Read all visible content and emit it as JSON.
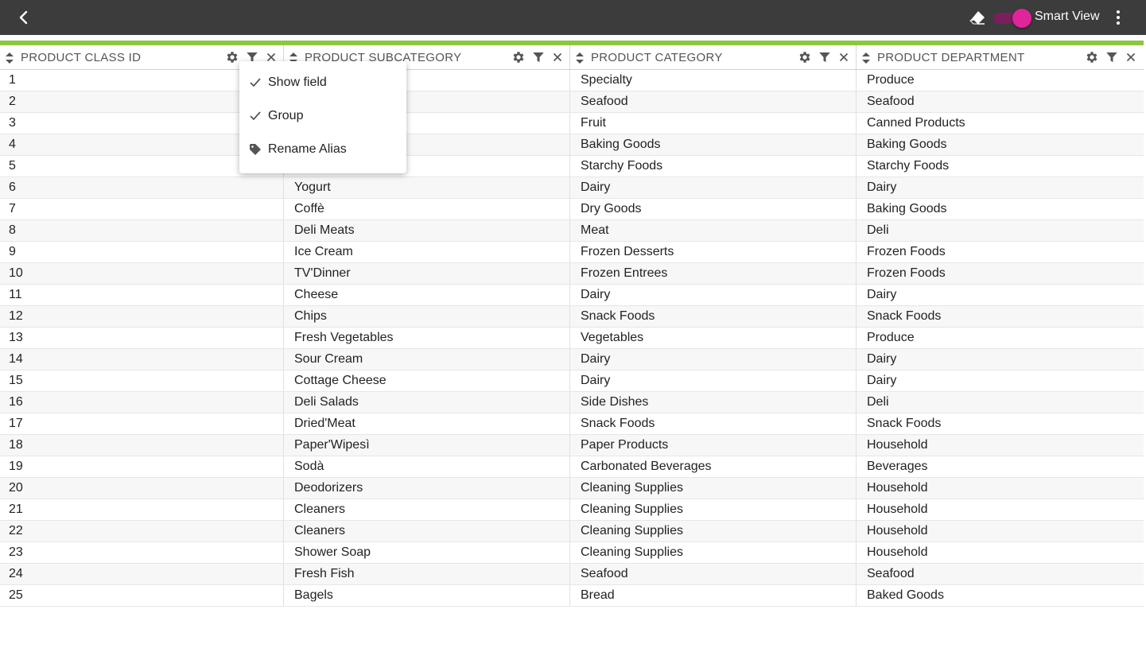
{
  "toolbar": {
    "smart_view_label": "Smart View",
    "smart_view_on": true,
    "accent_color": "#e0249a",
    "header_accent": "#8dc63f"
  },
  "columns": [
    {
      "title": "PRODUCT CLASS ID"
    },
    {
      "title": "PRODUCT SUBCATEGORY"
    },
    {
      "title": "PRODUCT CATEGORY"
    },
    {
      "title": "PRODUCT DEPARTMENT"
    }
  ],
  "rows": [
    [
      "1",
      "",
      "Specialty",
      "Produce"
    ],
    [
      "2",
      "",
      "Seafood",
      "Seafood"
    ],
    [
      "3",
      "",
      "Fruit",
      "Canned Products"
    ],
    [
      "4",
      "",
      "Baking Goods",
      "Baking Goods"
    ],
    [
      "5",
      "",
      "Starchy Foods",
      "Starchy Foods"
    ],
    [
      "6",
      "Yogurt",
      "Dairy",
      "Dairy"
    ],
    [
      "7",
      "Coffè",
      "Dry Goods",
      "Baking Goods"
    ],
    [
      "8",
      "Deli Meats",
      "Meat",
      "Deli"
    ],
    [
      "9",
      "Ice Cream",
      "Frozen Desserts",
      "Frozen Foods"
    ],
    [
      "10",
      "TV'Dinner",
      "Frozen Entrees",
      "Frozen Foods"
    ],
    [
      "11",
      "Cheese",
      "Dairy",
      "Dairy"
    ],
    [
      "12",
      "Chips",
      "Snack Foods",
      "Snack Foods"
    ],
    [
      "13",
      "Fresh Vegetables",
      "Vegetables",
      "Produce"
    ],
    [
      "14",
      "Sour Cream",
      "Dairy",
      "Dairy"
    ],
    [
      "15",
      "Cottage Cheese",
      "Dairy",
      "Dairy"
    ],
    [
      "16",
      "Deli Salads",
      "Side Dishes",
      "Deli"
    ],
    [
      "17",
      "Dried'Meat",
      "Snack Foods",
      "Snack Foods"
    ],
    [
      "18",
      "Paper'Wipesì",
      "Paper Products",
      "Household"
    ],
    [
      "19",
      "Sodà",
      "Carbonated Beverages",
      "Beverages"
    ],
    [
      "20",
      "Deodorizers",
      "Cleaning Supplies",
      "Household"
    ],
    [
      "21",
      "Cleaners",
      "Cleaning Supplies",
      "Household"
    ],
    [
      "22",
      "Cleaners",
      "Cleaning Supplies",
      "Household"
    ],
    [
      "23",
      "Shower Soap",
      "Cleaning Supplies",
      "Household"
    ],
    [
      "24",
      "Fresh Fish",
      "Seafood",
      "Seafood"
    ],
    [
      "25",
      "Bagels",
      "Bread",
      "Baked Goods"
    ]
  ],
  "context_menu": {
    "items": [
      {
        "label": "Show field",
        "icon": "check-icon"
      },
      {
        "label": "Group",
        "icon": "check-icon"
      },
      {
        "label": "Rename Alias",
        "icon": "tag-icon"
      }
    ]
  }
}
